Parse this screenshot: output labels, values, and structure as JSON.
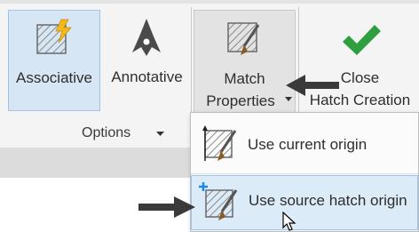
{
  "ribbon": {
    "buttons": {
      "associative": {
        "label": "Associative",
        "icon": "associative-hatch-icon"
      },
      "annotative": {
        "label": "Annotative",
        "icon": "annotative-icon"
      },
      "match_properties": {
        "label_line1": "Match",
        "label_line2": "Properties",
        "icon": "match-properties-brush-icon"
      },
      "close_hatch": {
        "label_line1": "Close",
        "label_line2": "Hatch Creation",
        "icon": "green-checkmark-icon"
      }
    },
    "panel_title": "Options",
    "panel_dropdown_icon": "triangle-down-icon"
  },
  "dropdown_menu": {
    "items": [
      {
        "label": "Use current origin",
        "icon": "current-origin-brush-icon"
      },
      {
        "label": "Use source hatch origin",
        "icon": "source-hatch-origin-brush-icon",
        "highlighted": true
      }
    ]
  },
  "annotations": {
    "arrow_color": "#3a3a3a",
    "arrow_right_icon": "pointer-arrow-left-icon",
    "arrow_menu_icon": "pointer-arrow-right-icon"
  },
  "colors": {
    "selected_bg": "#d6e6f4",
    "hover_bg": "#dcebf8",
    "check_green": "#2e9e3e",
    "hatch_yellow": "#f3b81b"
  }
}
